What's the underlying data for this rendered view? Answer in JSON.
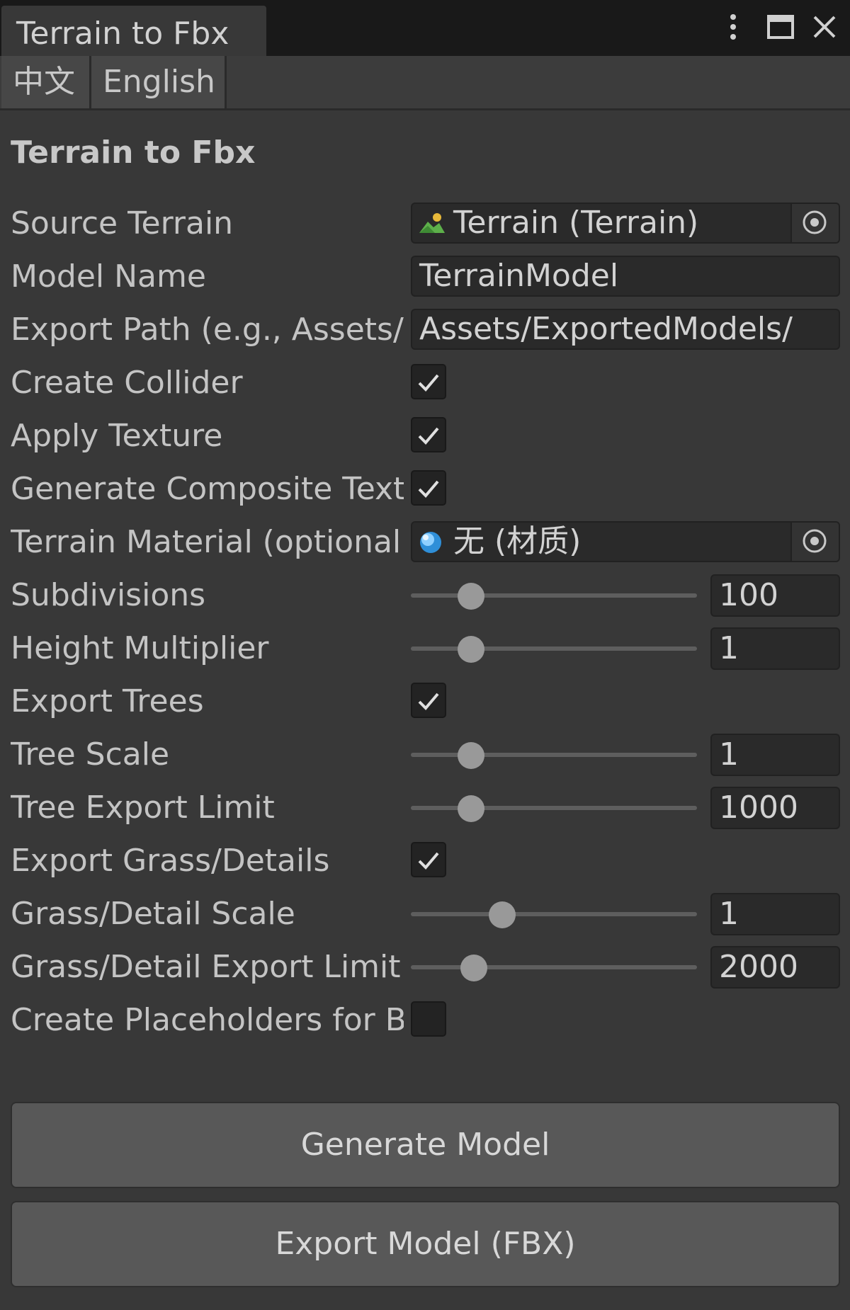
{
  "window": {
    "tab_title": "Terrain to Fbx",
    "controls": [
      "kebab-menu-icon",
      "maximize-icon",
      "close-icon"
    ]
  },
  "language": {
    "chinese": "中文",
    "english": "English"
  },
  "section_title": "Terrain to Fbx",
  "fields": {
    "source_terrain": {
      "label": "Source Terrain",
      "value": "Terrain (Terrain)",
      "icon": "terrain-icon"
    },
    "model_name": {
      "label": "Model Name",
      "value": "TerrainModel"
    },
    "export_path": {
      "label": "Export Path (e.g., Assets/M",
      "value": "Assets/ExportedModels/"
    },
    "create_collider": {
      "label": "Create Collider",
      "checked": true
    },
    "apply_texture": {
      "label": "Apply Texture",
      "checked": true
    },
    "composite_texture": {
      "label": "Generate Composite Text",
      "checked": true
    },
    "terrain_material": {
      "label": "Terrain Material (optional",
      "value": "无 (材质)",
      "icon": "material-icon"
    },
    "subdivisions": {
      "label": "Subdivisions",
      "value": "100",
      "slider_fraction": 0.21
    },
    "height_multiplier": {
      "label": "Height Multiplier",
      "value": "1",
      "slider_fraction": 0.21
    },
    "export_trees": {
      "label": "Export Trees",
      "checked": true
    },
    "tree_scale": {
      "label": "Tree Scale",
      "value": "1",
      "slider_fraction": 0.21
    },
    "tree_export_limit": {
      "label": "Tree Export Limit",
      "value": "1000",
      "slider_fraction": 0.21
    },
    "export_grass": {
      "label": "Export Grass/Details",
      "checked": true
    },
    "grass_scale": {
      "label": "Grass/Detail Scale",
      "value": "1",
      "slider_fraction": 0.32
    },
    "grass_export_limit": {
      "label": "Grass/Detail Export Limit",
      "value": "2000",
      "slider_fraction": 0.22
    },
    "placeholders": {
      "label": "Create Placeholders for B",
      "checked": false
    }
  },
  "buttons": {
    "generate": "Generate Model",
    "export": "Export Model (FBX)"
  },
  "colors": {
    "background": "#383838",
    "titlebar": "#191919",
    "field_bg": "#2a2a2a",
    "button_bg": "#585858"
  }
}
